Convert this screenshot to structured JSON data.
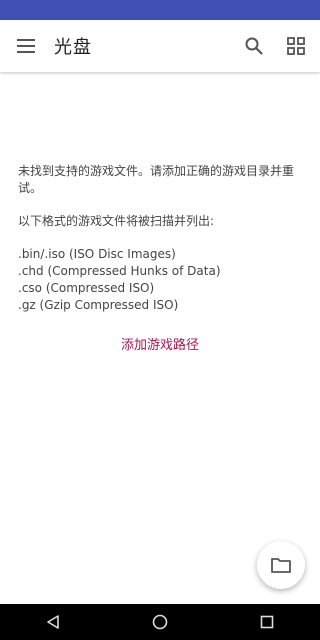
{
  "app_bar": {
    "title": "光盘",
    "menu_icon": "hamburger-menu-icon",
    "search_icon": "search-icon",
    "view_icon": "grid-view-icon"
  },
  "main": {
    "message": "未找到支持的游戏文件。请添加正确的游戏目录并重试。",
    "formats_intro": "以下格式的游戏文件将被扫描并列出:",
    "formats": [
      ".bin/.iso (ISO Disc Images)",
      ".chd (Compressed Hunks of Data)",
      ".cso (Compressed ISO)",
      ".gz (Gzip Compressed ISO)"
    ],
    "add_path_label": "添加游戏路径"
  },
  "fab": {
    "icon": "folder-icon"
  },
  "colors": {
    "status_bar": "#3f51b5",
    "accent": "#ad1457",
    "nav_bar": "#000000"
  },
  "nav": {
    "back_icon": "back-icon",
    "home_icon": "home-icon",
    "recents_icon": "recents-icon"
  }
}
